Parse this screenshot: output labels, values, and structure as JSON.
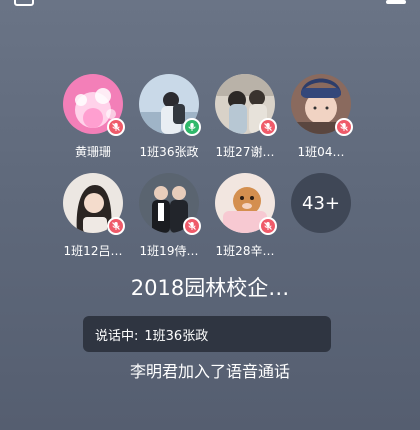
{
  "members": [
    {
      "name": "黄珊珊",
      "mic": "muted"
    },
    {
      "name": "1班36张政",
      "mic": "speaking"
    },
    {
      "name": "1班27谢…",
      "mic": "muted"
    },
    {
      "name": "1班04…",
      "mic": "muted"
    },
    {
      "name": "1班12吕…",
      "mic": "muted"
    },
    {
      "name": "1班19侍…",
      "mic": "muted"
    },
    {
      "name": "1班28辛…",
      "mic": "muted"
    }
  ],
  "more_count": "43+",
  "group_title": "2018园林校企…",
  "speaking_label": "说话中:",
  "speaking_name": "1班36张政",
  "join_notice": "李明君加入了语音通话",
  "colors": {
    "muted_badge": "#ef5b6a",
    "speaking_badge": "#2fb86a",
    "background": "#5f697b"
  },
  "icons": {
    "mic_muted": "mic-off-icon",
    "mic_speaking": "mic-icon",
    "minimize": "minimize-icon",
    "window": "window-icon"
  }
}
